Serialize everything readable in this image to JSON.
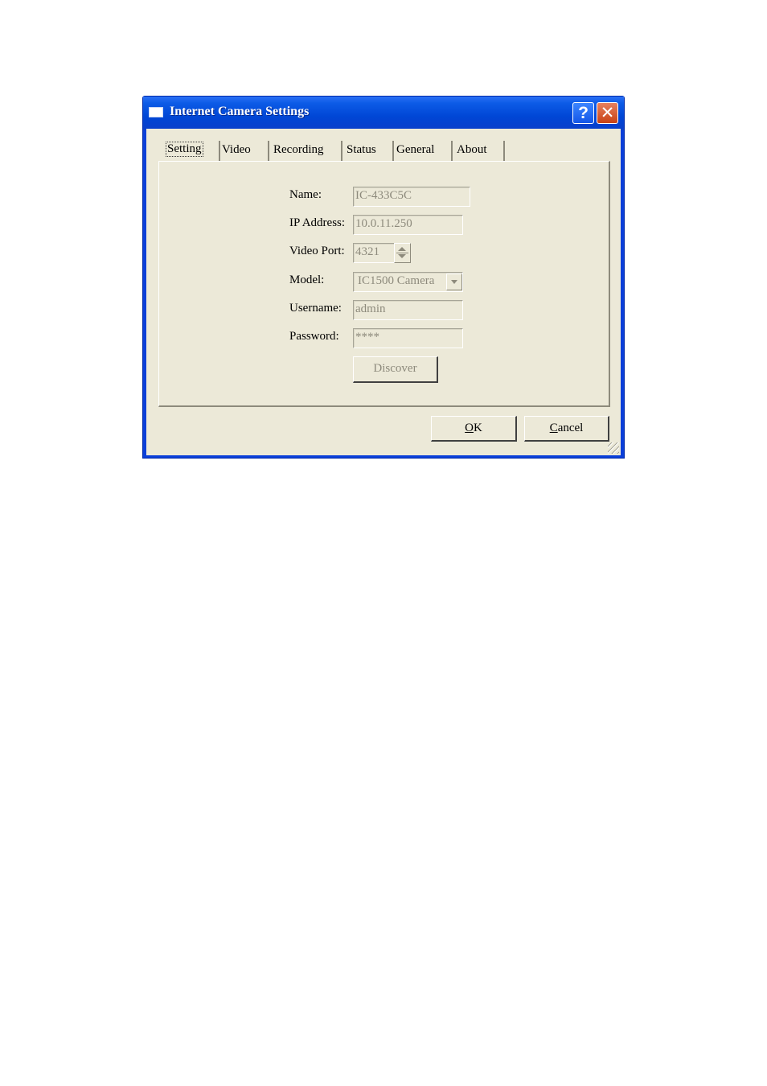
{
  "window": {
    "title": "Internet Camera Settings",
    "help_glyph": "?",
    "close_glyph": "✕"
  },
  "tabs": [
    {
      "label": "Setting",
      "active": true
    },
    {
      "label": "Video",
      "active": false
    },
    {
      "label": "Recording",
      "active": false
    },
    {
      "label": "Status",
      "active": false
    },
    {
      "label": "General",
      "active": false
    },
    {
      "label": "About",
      "active": false
    }
  ],
  "form": {
    "name": {
      "label": "Name:",
      "value": "IC-433C5C"
    },
    "ip": {
      "label": "IP Address:",
      "value": "10.0.11.250"
    },
    "port": {
      "label": "Video Port:",
      "value": "4321"
    },
    "model": {
      "label": "Model:",
      "value": "IC1500 Camera"
    },
    "username": {
      "label": "Username:",
      "value": "admin"
    },
    "password": {
      "label": "Password:",
      "value": "****"
    },
    "discover_label": "Discover"
  },
  "buttons": {
    "ok": {
      "accel": "O",
      "rest": "K"
    },
    "cancel": {
      "accel": "C",
      "rest": "ancel"
    }
  },
  "icons": [
    "window-icon",
    "help-icon",
    "close-icon",
    "spin-up-icon",
    "spin-down-icon",
    "dropdown-arrow-icon",
    "resize-grip-icon"
  ],
  "colors": {
    "titlebar": "#0046d5",
    "dialog_bg": "#ece9d8",
    "close_button": "#c84215",
    "disabled_text": "#8d8a7c"
  }
}
